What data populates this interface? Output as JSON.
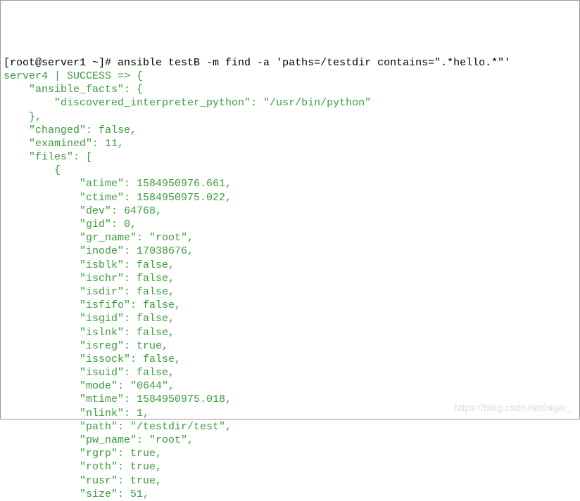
{
  "prompt": "[root@server1 ~]# ansible testB -m find -a 'paths=/testdir contains=\".*hello.*\"'",
  "header": "server4 | SUCCESS => {",
  "lines": [
    "    \"ansible_facts\": {",
    "        \"discovered_interpreter_python\": \"/usr/bin/python\"",
    "    },",
    "    \"changed\": false,",
    "    \"examined\": 11,",
    "    \"files\": [",
    "        {",
    "            \"atime\": 1584950976.661,",
    "            \"ctime\": 1584950975.022,",
    "            \"dev\": 64768,",
    "            \"gid\": 0,",
    "            \"gr_name\": \"root\",",
    "            \"inode\": 17038676,",
    "            \"isblk\": false,",
    "            \"ischr\": false,",
    "            \"isdir\": false,",
    "            \"isfifo\": false,",
    "            \"isgid\": false,",
    "            \"islnk\": false,",
    "            \"isreg\": true,",
    "            \"issock\": false,",
    "            \"isuid\": false,",
    "            \"mode\": \"0644\",",
    "            \"mtime\": 1584950975.018,",
    "            \"nlink\": 1,",
    "            \"path\": \"/testdir/test\",",
    "            \"pw_name\": \"root\",",
    "            \"rgrp\": true,",
    "            \"roth\": true,",
    "            \"rusr\": true,",
    "            \"size\": 51,"
  ],
  "watermark": "https://blog.csdn.net/nigar_"
}
